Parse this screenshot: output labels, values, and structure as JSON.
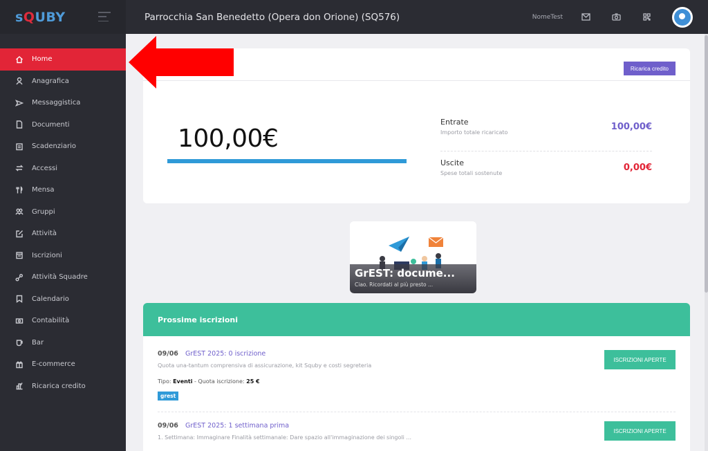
{
  "app": {
    "logo_prefix": "s",
    "logo_q": "Q",
    "logo_suffix": "UBY",
    "parish_title": "Parrocchia San Benedetto (Opera don Orione) (SQ576)",
    "username": "NomeTest",
    "icons": [
      "mail-icon",
      "camera-icon",
      "qr-code-icon",
      "avatar"
    ]
  },
  "sidebar": {
    "items": [
      {
        "label": "Home",
        "icon": "home-icon",
        "active": true
      },
      {
        "label": "Anagrafica",
        "icon": "user-icon"
      },
      {
        "label": "Messaggistica",
        "icon": "send-icon"
      },
      {
        "label": "Documenti",
        "icon": "document-icon"
      },
      {
        "label": "Scadenziario",
        "icon": "calendar-list-icon"
      },
      {
        "label": "Accessi",
        "icon": "swap-icon"
      },
      {
        "label": "Mensa",
        "icon": "cutlery-icon"
      },
      {
        "label": "Gruppi",
        "icon": "group-icon"
      },
      {
        "label": "Attività",
        "icon": "edit-icon"
      },
      {
        "label": "Iscrizioni",
        "icon": "form-icon"
      },
      {
        "label": "Attività Squadre",
        "icon": "teams-icon"
      },
      {
        "label": "Calendario",
        "icon": "bookmark-icon"
      },
      {
        "label": "Contabilità",
        "icon": "money-icon"
      },
      {
        "label": "Bar",
        "icon": "cup-icon"
      },
      {
        "label": "E-commerce",
        "icon": "gift-icon"
      },
      {
        "label": "Ricarica credito",
        "icon": "chart-icon"
      }
    ]
  },
  "credit": {
    "recharge_button": "Ricarica credito",
    "balance": "100,00€",
    "income_title": "Entrate",
    "income_sub": "Importo totale ricaricato",
    "income_value": "100,00€",
    "expense_title": "Uscite",
    "expense_sub": "Spese totali sostenute",
    "expense_value": "0,00€"
  },
  "news": {
    "title": "GrEST: docume...",
    "subtitle": "Ciao. Ricordati al più presto ..."
  },
  "registrations": {
    "header": "Prossime iscrizioni",
    "items": [
      {
        "date": "09/06",
        "name": "GrEST 2025: 0 iscrizione",
        "description": "Quota una-tantum comprensiva di assicurazione, kit Squby e costi segreteria",
        "type_label": "Tipo:",
        "type_value": "Eventi",
        "fee_label": "- Quota iscrizione:",
        "fee_value": "25 €",
        "tag": "grest",
        "button": "ISCRIZIONI APERTE"
      },
      {
        "date": "09/06",
        "name": "GrEST 2025: 1 settimana prima",
        "description": "1. Settimana: Immaginare Finalità settimanale: Dare spazio all'immaginazione dei singoli ...",
        "button": "ISCRIZIONI APERTE"
      }
    ]
  },
  "colors": {
    "sidebar_bg": "#2b2c33",
    "active_red": "#e22537",
    "accent_purple": "#6f5fcb",
    "accent_green": "#3dbf9b",
    "accent_blue": "#2f9ad8"
  }
}
